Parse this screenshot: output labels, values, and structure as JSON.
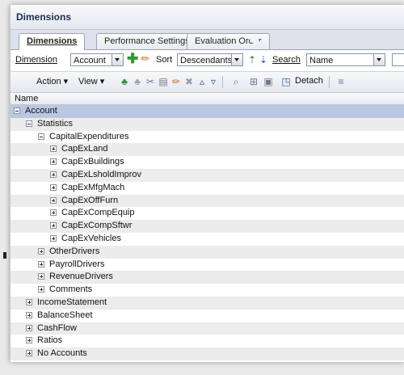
{
  "panel": {
    "title": "Dimensions"
  },
  "tabs": [
    {
      "label": "Dimensions",
      "active": true
    },
    {
      "label": "Performance Settings",
      "active": false
    },
    {
      "label": "Evaluation Order",
      "active": false
    }
  ],
  "filter": {
    "dimension_label": "Dimension",
    "dimension_value": "Account",
    "sort_label": "Sort",
    "sort_value": "Descendants",
    "search_label": "Search",
    "search_value": "Name"
  },
  "toolbar": {
    "action_label": "Action",
    "view_label": "View",
    "detach_label": "Detach"
  },
  "tree": {
    "column_header": "Name",
    "rows": [
      {
        "label": "Account",
        "level": 0,
        "state": "minus"
      },
      {
        "label": "Statistics",
        "level": 1,
        "state": "minus"
      },
      {
        "label": "CapitalExpenditures",
        "level": 2,
        "state": "minus"
      },
      {
        "label": "CapExLand",
        "level": 3,
        "state": "plus"
      },
      {
        "label": "CapExBuildings",
        "level": 3,
        "state": "plus"
      },
      {
        "label": "CapExLsholdImprov",
        "level": 3,
        "state": "plus"
      },
      {
        "label": "CapExMfgMach",
        "level": 3,
        "state": "plus"
      },
      {
        "label": "CapExOffFurn",
        "level": 3,
        "state": "plus"
      },
      {
        "label": "CapExCompEquip",
        "level": 3,
        "state": "plus"
      },
      {
        "label": "CapExCompSftwr",
        "level": 3,
        "state": "plus"
      },
      {
        "label": "CapExVehicles",
        "level": 3,
        "state": "plus"
      },
      {
        "label": "OtherDrivers",
        "level": 2,
        "state": "plus"
      },
      {
        "label": "PayrollDrivers",
        "level": 2,
        "state": "plus"
      },
      {
        "label": "RevenueDrivers",
        "level": 2,
        "state": "plus"
      },
      {
        "label": "Comments",
        "level": 2,
        "state": "plus"
      },
      {
        "label": "IncomeStatement",
        "level": 1,
        "state": "plus"
      },
      {
        "label": "BalanceSheet",
        "level": 1,
        "state": "plus"
      },
      {
        "label": "CashFlow",
        "level": 1,
        "state": "plus"
      },
      {
        "label": "Ratios",
        "level": 1,
        "state": "plus"
      },
      {
        "label": "No Accounts",
        "level": 1,
        "state": "plus"
      }
    ]
  }
}
